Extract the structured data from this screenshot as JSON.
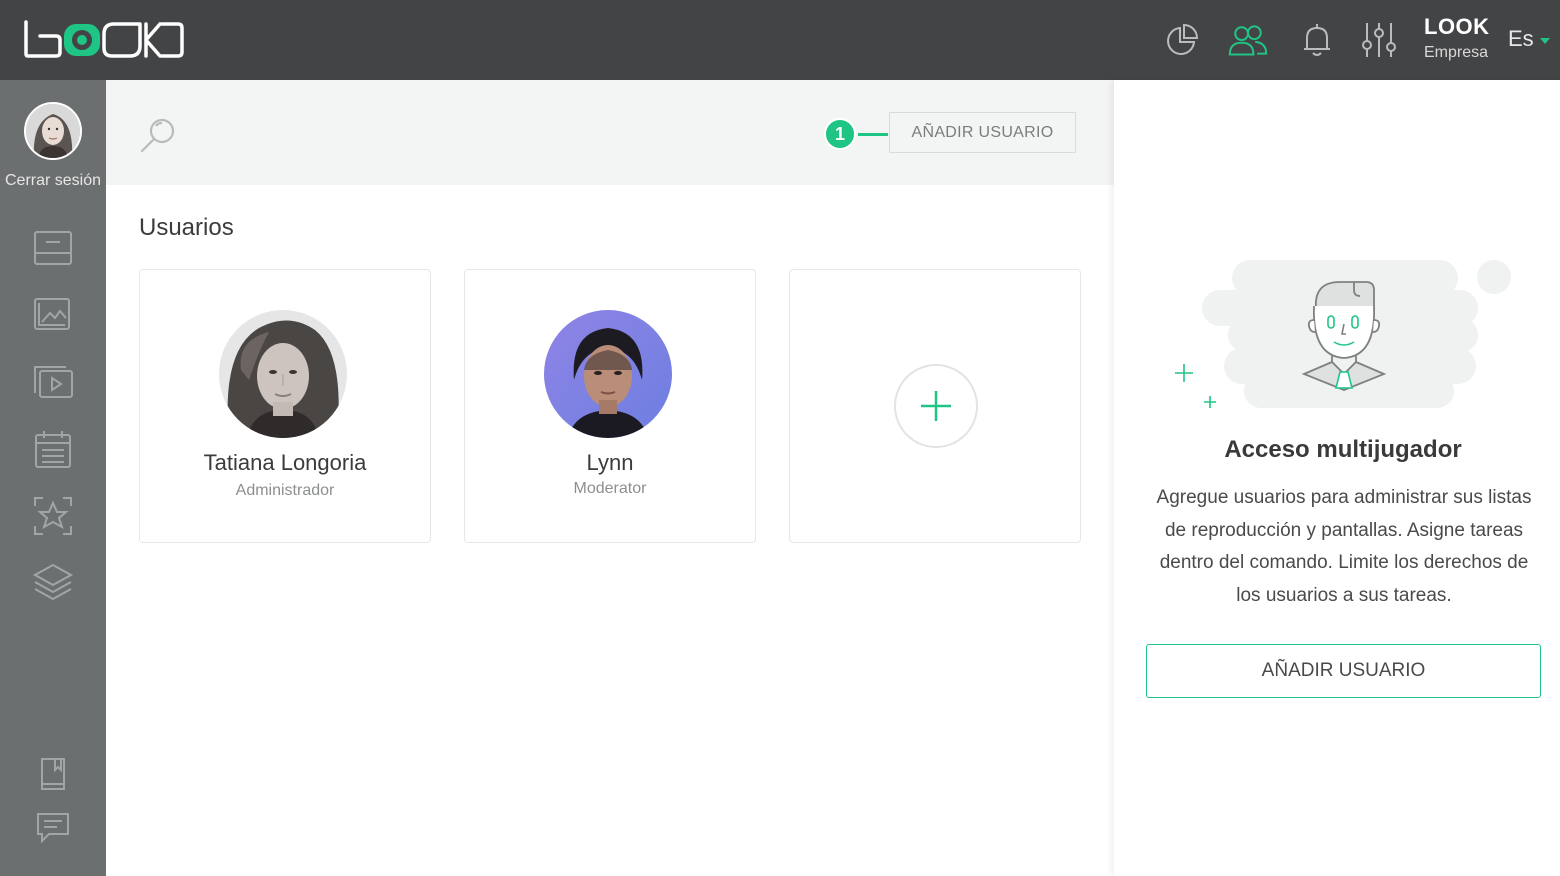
{
  "topbar": {
    "logo_text": "LOOK",
    "brand_name": "LOOK",
    "brand_sub": "Empresa",
    "language": "Es",
    "accent_color": "#1fc584",
    "icons": [
      "stats-icon",
      "users-icon",
      "bell-icon",
      "settings-sliders-icon"
    ]
  },
  "sidebar": {
    "logout_label": "Cerrar sesión",
    "items": [
      "screens-icon",
      "images-icon",
      "video-playlist-icon",
      "calendar-icon",
      "favorites-icon",
      "layers-icon",
      "docs-book-icon",
      "chat-icon"
    ]
  },
  "toolbar": {
    "step_number": "1",
    "add_user_label": "AÑADIR USUARIO"
  },
  "main": {
    "section_title": "Usuarios",
    "users": [
      {
        "name": "Tatiana Longoria",
        "role": "Administrador"
      },
      {
        "name": "Lynn",
        "role": "Moderator"
      }
    ]
  },
  "panel": {
    "title": "Acceso multijugador",
    "description": "Agregue usuarios para administrar sus listas de reproducción y pantallas. Asigne tareas dentro del comando. Limite los derechos de los usuarios a sus tareas.",
    "add_user_label": "AÑADIR USUARIO"
  }
}
